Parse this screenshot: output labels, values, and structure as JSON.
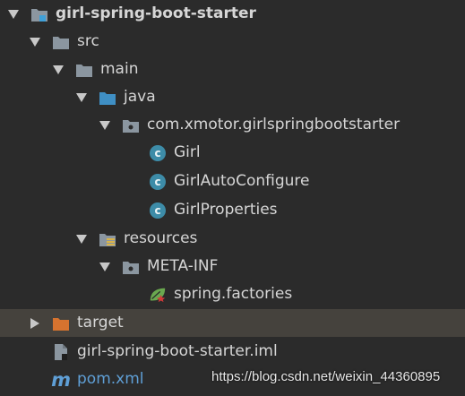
{
  "tree": {
    "root": {
      "label": "girl-spring-boot-starter"
    },
    "src": {
      "label": "src"
    },
    "main": {
      "label": "main"
    },
    "java": {
      "label": "java"
    },
    "package": {
      "label": "com.xmotor.girlspringbootstarter"
    },
    "class_girl": {
      "label": "Girl",
      "badge": "c"
    },
    "class_autoconfigure": {
      "label": "GirlAutoConfigure",
      "badge": "c"
    },
    "class_properties": {
      "label": "GirlProperties",
      "badge": "c"
    },
    "resources": {
      "label": "resources"
    },
    "meta_inf": {
      "label": "META-INF"
    },
    "spring_factories": {
      "label": "spring.factories"
    },
    "target": {
      "label": "target"
    },
    "iml": {
      "label": "girl-spring-boot-starter.iml"
    },
    "pom": {
      "label": "pom.xml",
      "icon_letter": "m"
    }
  },
  "watermark": "https://blog.csdn.net/weixin_44360895",
  "colors": {
    "background": "#2b2b2b",
    "selected_row": "#45423d",
    "folder": "#8b96a0",
    "source_folder": "#3f8fc4",
    "target_folder": "#d6732f",
    "class_badge": "#3d8ca8",
    "pom_text": "#5f9fd6"
  }
}
